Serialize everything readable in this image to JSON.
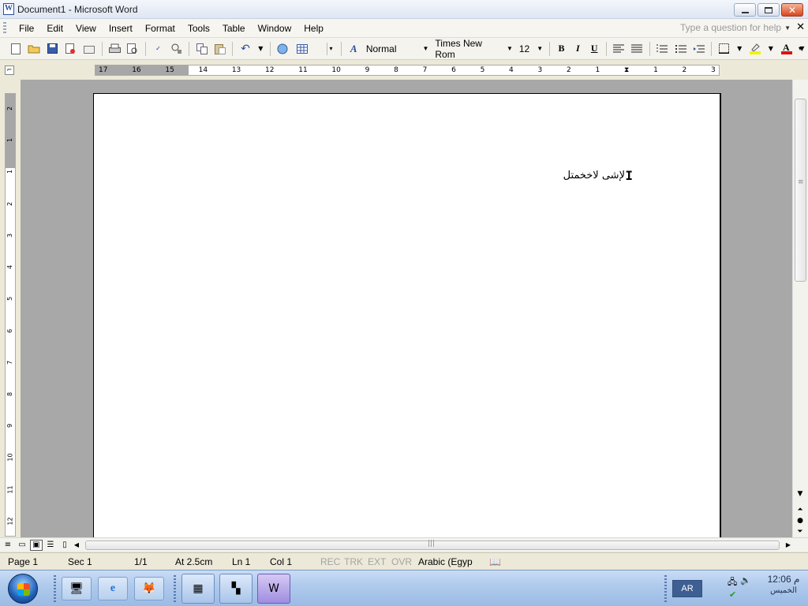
{
  "window": {
    "title": "Document1 - Microsoft Word",
    "buttons": {
      "minimize": "minimize",
      "restore": "restore",
      "close": "✕"
    }
  },
  "menu": {
    "items": [
      "File",
      "Edit",
      "View",
      "Insert",
      "Format",
      "Tools",
      "Table",
      "Window",
      "Help"
    ],
    "help_placeholder": "Type a question for help",
    "close_glyph": "✕"
  },
  "toolbar": {
    "style_value": "Normal",
    "font_value": "Times New Rom",
    "size_value": "12",
    "bold_label": "B",
    "italic_label": "I",
    "underline_label": "U"
  },
  "ruler": {
    "labels": [
      "17",
      "16",
      "15",
      "14",
      "13",
      "12",
      "11",
      "10",
      "9",
      "8",
      "7",
      "6",
      "5",
      "4",
      "3",
      "2",
      "1",
      "",
      "1",
      "2",
      "3"
    ],
    "vertical_labels": [
      "2",
      "1",
      "1",
      "2",
      "3",
      "4",
      "5",
      "6",
      "7",
      "8",
      "9",
      "10",
      "11",
      "12"
    ]
  },
  "document": {
    "text": "لإشى لاخخمتل"
  },
  "status": {
    "page": "Page 1",
    "sec": "Sec 1",
    "pages": "1/1",
    "at": "At 2.5cm",
    "ln": "Ln 1",
    "col": "Col 1",
    "rec": "REC",
    "trk": "TRK",
    "ext": "EXT",
    "ovr": "OVR",
    "language": "Arabic (Egyp"
  },
  "taskbar": {
    "language_indicator": "AR",
    "clock_time": "12:06 م",
    "clock_day": "الخميس"
  },
  "colors": {
    "highlight_color": "#f3f300",
    "font_color": "#e01010",
    "doc_background": "#a8a8a8"
  }
}
